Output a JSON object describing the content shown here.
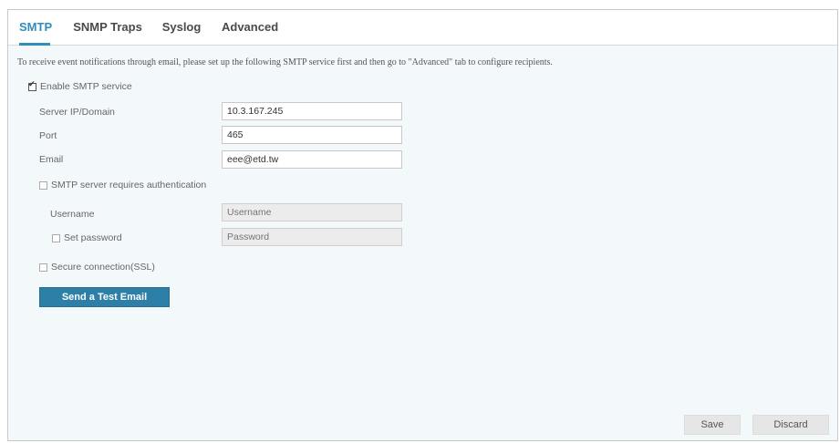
{
  "tabs": [
    {
      "label": "SMTP",
      "active": true
    },
    {
      "label": "SNMP Traps",
      "active": false
    },
    {
      "label": "Syslog",
      "active": false
    },
    {
      "label": "Advanced",
      "active": false
    }
  ],
  "intro_text": "To receive event notifications through email, please set up the following SMTP service first and then go to \"Advanced\" tab to configure recipients.",
  "enable_smtp": {
    "label": "Enable SMTP service",
    "checked": true
  },
  "fields": {
    "server": {
      "label": "Server IP/Domain",
      "value": "10.3.167.245"
    },
    "port": {
      "label": "Port",
      "value": "465"
    },
    "email": {
      "label": "Email",
      "value": "eee@etd.tw"
    }
  },
  "auth": {
    "label": "SMTP server requires authentication",
    "checked": false
  },
  "username": {
    "label": "Username",
    "placeholder": "Username"
  },
  "set_password": {
    "label": "Set password",
    "checked": false,
    "placeholder": "Password"
  },
  "ssl": {
    "label": "Secure connection(SSL)",
    "checked": false
  },
  "buttons": {
    "test_email": "Send a Test Email",
    "save": "Save",
    "discard": "Discard"
  },
  "colors": {
    "accent": "#2f8fb8",
    "primary_button": "#2e7fa8",
    "panel_bg": "#f3f8fb"
  }
}
